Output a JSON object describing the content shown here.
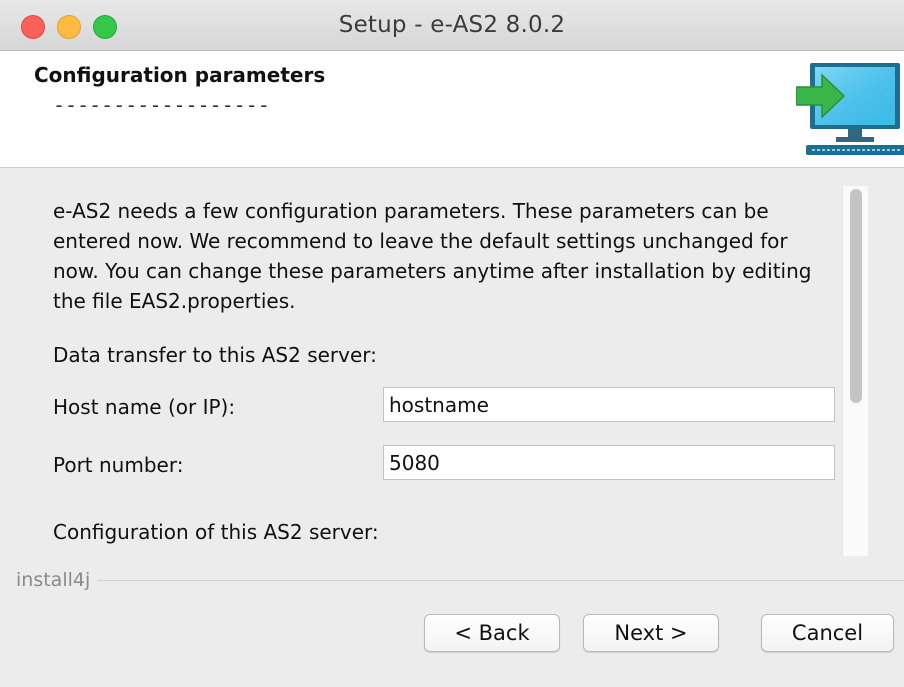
{
  "window": {
    "title": "Setup - e-AS2 8.0.2"
  },
  "header": {
    "title": "Configuration parameters",
    "subtitle": "------------------",
    "icon": "monitor-arrow-icon"
  },
  "content": {
    "description": "e-AS2 needs a few configuration parameters. These parameters can be entered now. We recommend to leave the default settings unchanged for now. You can change these parameters anytime after installation by editing the file EAS2.properties.",
    "section_transfer": "Data transfer to this AS2 server:",
    "host_label": "Host name (or IP):",
    "host_value": "hostname",
    "port_label": "Port number:",
    "port_value": "5080",
    "section_config": "Configuration of this AS2 server:"
  },
  "footer": {
    "brand": "install4j",
    "back_label": "< Back",
    "next_label": "Next >",
    "cancel_label": "Cancel"
  },
  "colors": {
    "close": "#fc605b",
    "minimize": "#fdbc40",
    "maximize": "#34c84a",
    "arrow_green": "#39b54a",
    "screen_blue": "#3fb8e8"
  }
}
